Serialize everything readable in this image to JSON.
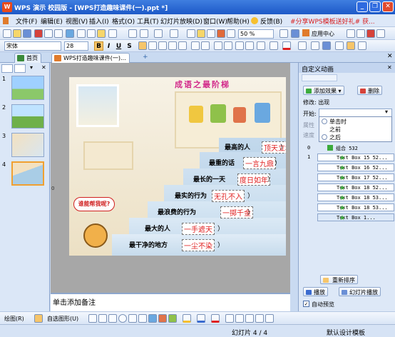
{
  "window": {
    "title": "WPS 演示 校园版 - [WPS打造趣味课件(一).ppt *]",
    "controls": [
      "_",
      "❐",
      "✕"
    ]
  },
  "menu": {
    "items": [
      "文件(F)",
      "编辑(E)",
      "视图(V)",
      "插入(I)",
      "格式(O)",
      "工具(T)",
      "幻灯片放映(D)",
      "窗口(W)",
      "帮助(H)"
    ],
    "feedback": "反馈(B)",
    "ad": "#分享WPS模板送好礼# 获..."
  },
  "toolbar": {
    "zoom": "50 %",
    "app_center": "应用中心"
  },
  "format": {
    "font": "宋体",
    "size": "28",
    "bold": "B",
    "italic": "I",
    "underline": "U",
    "shadow": "S"
  },
  "doc_tabs": [
    {
      "label": "首页"
    },
    {
      "label": "WPS打造趣味课件(一)..."
    }
  ],
  "slides": [
    {
      "num": "1"
    },
    {
      "num": "2"
    },
    {
      "num": "3"
    },
    {
      "num": "4"
    }
  ],
  "slide": {
    "title": "成语之最阶梯",
    "bubble": "谁能帮我呢?",
    "stair_labels": [
      "最高的人",
      "最重的话",
      "最长的一天",
      "最实的行为",
      "最浪费的行为",
      "最大的人",
      "最干净的地方"
    ],
    "answers": [
      "顶天立地",
      "一言九鼎",
      "度日如年",
      "无孔不入",
      "一掷千金",
      "一手遮天",
      "一尘不染"
    ],
    "closers": [
      "）",
      "）",
      "）",
      "）",
      "）",
      "）",
      "）"
    ],
    "ruler_mark": "0"
  },
  "notes": {
    "placeholder": "单击添加备注"
  },
  "custom_animation": {
    "panel_title": "自定义动画",
    "add_effect": "添加效果",
    "delete": "删除",
    "modify_label": "修改: 出现",
    "start_label": "开始:",
    "property_label": "属性",
    "speed_label": "速度",
    "start_options": [
      "单击时",
      "之前",
      "之后"
    ],
    "group_row": {
      "num": "0",
      "label": "组合 532"
    },
    "effects": [
      {
        "num": "1",
        "label": "Text Box 15 52..."
      },
      {
        "num": "",
        "label": "Text Box 16 52..."
      },
      {
        "num": "",
        "label": "Text Box 17 52..."
      },
      {
        "num": "",
        "label": "Text Box 18 52..."
      },
      {
        "num": "",
        "label": "Text Box 18 53..."
      },
      {
        "num": "",
        "label": "Text Box 18 53..."
      },
      {
        "num": "",
        "label": "Text Box 1..."
      }
    ],
    "reorder": "重新排序",
    "play": "播放",
    "slideshow": "幻灯片播放",
    "autopreview": "自动预览"
  },
  "drawbar": {
    "draw": "绘图(R)",
    "autoshapes": "自选图形(U)"
  },
  "status": {
    "slide_count": "幻灯片 4 / 4",
    "design": "默认设计模板"
  }
}
